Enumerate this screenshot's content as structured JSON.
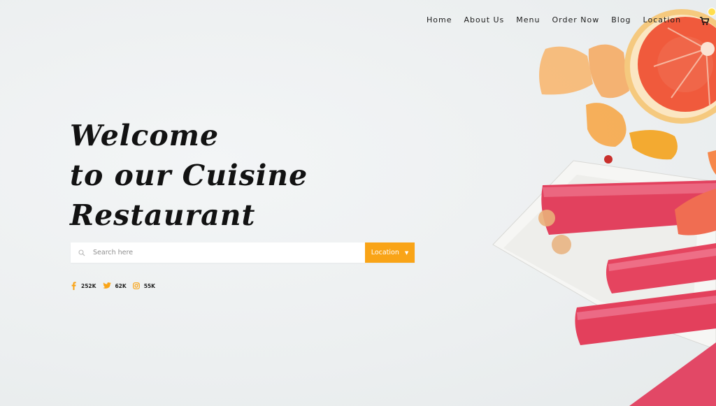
{
  "nav": {
    "items": [
      {
        "label": "Home"
      },
      {
        "label": "About Us"
      },
      {
        "label": "Menu"
      },
      {
        "label": "Order Now"
      },
      {
        "label": "Blog"
      },
      {
        "label": "Location"
      }
    ],
    "cart_icon": "cart-icon",
    "search_icon": "search-icon"
  },
  "hero": {
    "line1": "Welcome",
    "line2": "to our Cuisine",
    "line3": "Restaurant"
  },
  "search": {
    "placeholder": "Search here",
    "location_label": "Location"
  },
  "social": [
    {
      "icon": "facebook-icon",
      "count": "252K"
    },
    {
      "icon": "twitter-icon",
      "count": "62K"
    },
    {
      "icon": "instagram-icon",
      "count": "55K"
    }
  ],
  "colors": {
    "accent": "#f9a417",
    "badge": "#ffde4d",
    "text": "#121212",
    "background": "#eef1f2"
  }
}
